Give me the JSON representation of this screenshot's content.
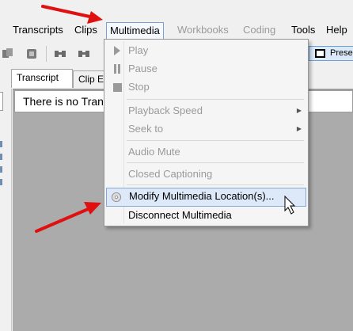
{
  "menubar": {
    "items": [
      {
        "label": "Transcripts",
        "state": "enabled"
      },
      {
        "label": "Clips",
        "state": "enabled"
      },
      {
        "label": "Multimedia",
        "state": "active"
      },
      {
        "label": "Workbooks",
        "state": "disabled"
      },
      {
        "label": "Coding",
        "state": "disabled"
      },
      {
        "label": "Tools",
        "state": "enabled"
      },
      {
        "label": "Help",
        "state": "enabled"
      }
    ]
  },
  "toolbar": {
    "present_label": "Prese",
    "icons": [
      "copy-icon",
      "paste-icon",
      "find-icon",
      "find-next-icon"
    ]
  },
  "tabs": [
    {
      "label": "Transcript",
      "selected": true
    },
    {
      "label": "Clip Ed",
      "selected": false
    }
  ],
  "document": {
    "notice": "There is no Tran"
  },
  "multimedia_menu": {
    "items": [
      {
        "label": "Play",
        "enabled": false,
        "icon": "play-icon"
      },
      {
        "label": "Pause",
        "enabled": false,
        "icon": "pause-icon"
      },
      {
        "label": "Stop",
        "enabled": false,
        "icon": "stop-icon"
      },
      {
        "label": "Playback Speed",
        "enabled": false,
        "submenu": true
      },
      {
        "label": "Seek to",
        "enabled": false,
        "submenu": true
      },
      {
        "label": "Audio Mute",
        "enabled": false
      },
      {
        "label": "Closed Captioning",
        "enabled": false
      },
      {
        "label": "Modify Multimedia Location(s)...",
        "enabled": true,
        "highlighted": true,
        "icon": "disc-icon"
      },
      {
        "label": "Disconnect Multimedia",
        "enabled": true
      }
    ]
  },
  "colors": {
    "annotation_arrow": "#e01010",
    "highlight_fill": "#dde9f9",
    "highlight_border": "#82a9dc",
    "content_background": "#ababab"
  }
}
